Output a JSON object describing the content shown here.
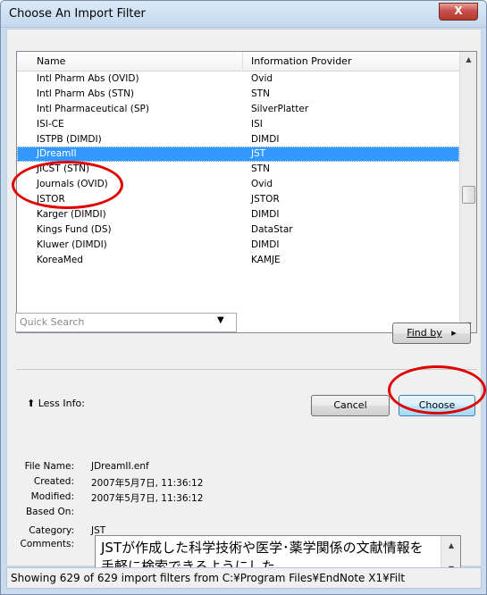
{
  "window": {
    "title": "Choose An Import Filter",
    "close_label": "X"
  },
  "list": {
    "headers": {
      "name": "Name",
      "provider": "Information Provider"
    },
    "rows": [
      {
        "name": "Intl Pharm Abs (OVID)",
        "provider": "Ovid"
      },
      {
        "name": "Intl Pharm Abs (STN)",
        "provider": "STN"
      },
      {
        "name": "Intl Pharmaceutical (SP)",
        "provider": "SilverPlatter"
      },
      {
        "name": "ISI-CE",
        "provider": "ISI"
      },
      {
        "name": "ISTPB (DIMDI)",
        "provider": "DIMDI"
      },
      {
        "name": "JDreamII",
        "provider": "JST",
        "selected": true
      },
      {
        "name": "JICST (STN)",
        "provider": "STN"
      },
      {
        "name": "Journals (OVID)",
        "provider": "Ovid"
      },
      {
        "name": "JSTOR",
        "provider": "JSTOR"
      },
      {
        "name": "Karger (DIMDI)",
        "provider": "DIMDI"
      },
      {
        "name": "Kings Fund (DS)",
        "provider": "DataStar"
      },
      {
        "name": "Kluwer (DIMDI)",
        "provider": "DIMDI"
      },
      {
        "name": "KoreaMed",
        "provider": "KAMJE"
      }
    ]
  },
  "quick_search": {
    "placeholder": "Quick Search"
  },
  "buttons": {
    "find_by": "Find by",
    "cancel": "Cancel",
    "choose": "Choose"
  },
  "less_info": "Less Info:",
  "info": {
    "file_name_label": "File Name:",
    "file_name": "JDreamII.enf",
    "created_label": "Created:",
    "created": "2007年5月7日, 11:36:12",
    "modified_label": "Modified:",
    "modified": "2007年5月7日, 11:36:12",
    "based_on_label": "Based On:",
    "based_on": "",
    "category_label": "Category:",
    "category": "JST",
    "comments_label": "Comments:",
    "comments": "JSTが作成した科学技術や医学･薬学関係の文献情報を手軽に検索できるようにした"
  },
  "status": "Showing 629 of 629 import filters from C:¥Program Files¥EndNote X1¥Filt",
  "colors": {
    "selection": "#3399ff",
    "annotation": "#e00000"
  }
}
